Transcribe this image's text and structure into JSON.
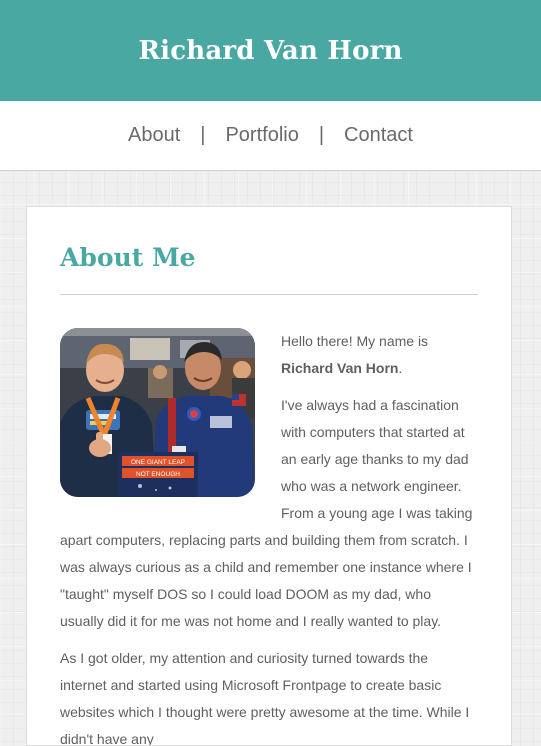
{
  "header": {
    "title": "Richard Van Horn"
  },
  "nav": {
    "items": [
      {
        "label": "About"
      },
      {
        "label": "Portfolio"
      },
      {
        "label": "Contact"
      }
    ],
    "separator": "|"
  },
  "about": {
    "heading": "About Me",
    "photo": {
      "banner_text_line1": "ONE GIANT LEAP",
      "banner_text_line2": "NOT ENOUGH"
    },
    "intro_before": "Hello there! My name is ",
    "intro_name": "Richard Van Horn",
    "intro_after": ".",
    "paragraph2": "I've always had a fascination with computers that started at an early age thanks to my dad who was a network engineer. From a young age I was taking apart computers, replacing parts and building them from scratch. I was always curious as a child and remember one instance where I \"taught\" myself DOS so I could load DOOM as my dad, who usually did it for me was not home and I really wanted to play.",
    "paragraph3": "As I got older, my attention and curiosity turned towards the internet and started using Microsoft Frontpage to create basic websites which I thought were pretty awesome at the time. While I didn't have any"
  }
}
